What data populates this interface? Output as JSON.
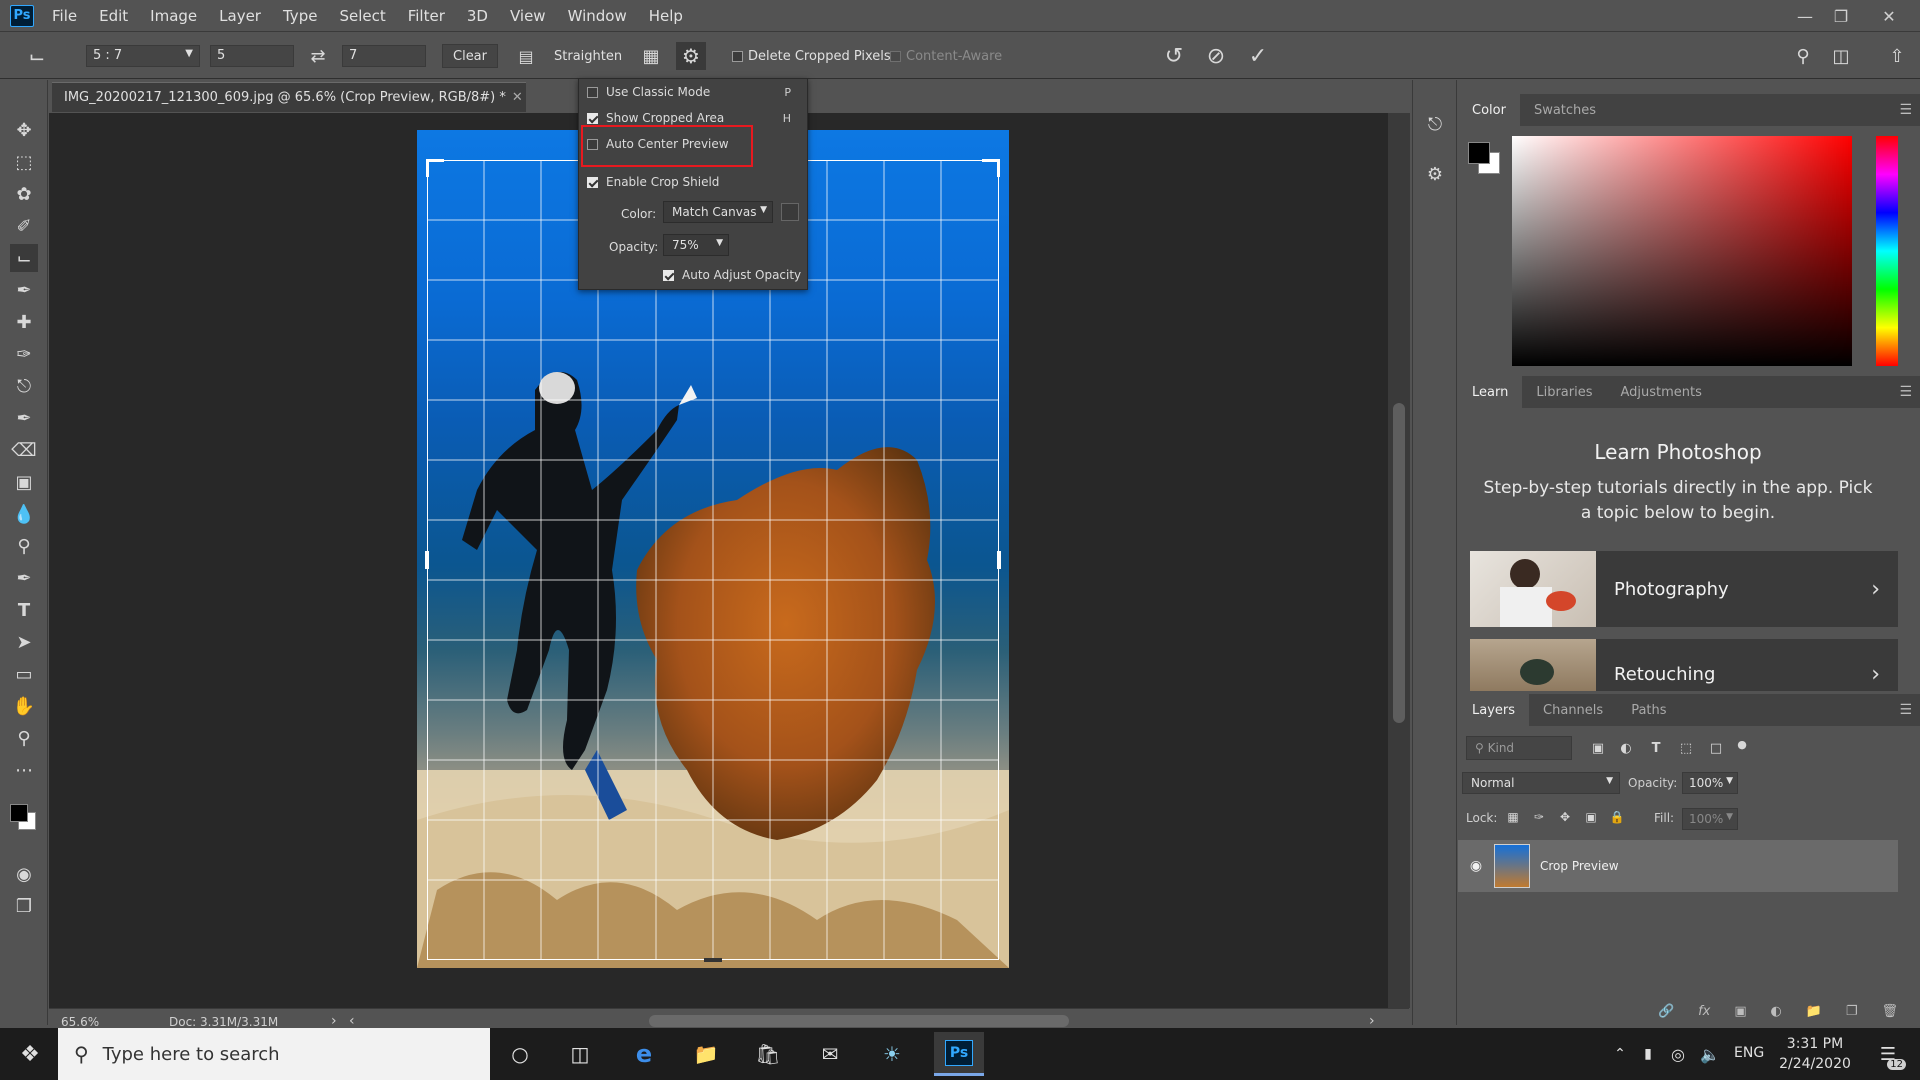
{
  "app": {
    "logo": "Ps"
  },
  "menu": [
    "File",
    "Edit",
    "Image",
    "Layer",
    "Type",
    "Select",
    "Filter",
    "3D",
    "View",
    "Window",
    "Help"
  ],
  "options_bar": {
    "ratio": "5 : 7",
    "width": "5",
    "height": "7",
    "clear_label": "Clear",
    "straighten_label": "Straighten",
    "delete_cropped_label": "Delete Cropped Pixels",
    "content_aware_label": "Content-Aware"
  },
  "document": {
    "tab_title": "IMG_20200217_121300_609.jpg @ 65.6% (Crop Preview, RGB/8#) *",
    "zoom": "65.6%",
    "doc_info": "Doc: 3.31M/3.31M"
  },
  "gear_menu": {
    "items": [
      {
        "label": "Use Classic Mode",
        "key": "P",
        "checked": false
      },
      {
        "label": "Show Cropped Area",
        "key": "H",
        "checked": true
      },
      {
        "label": "Auto Center Preview",
        "key": "",
        "checked": false
      },
      {
        "label": "Enable Crop Shield",
        "key": "",
        "checked": true
      }
    ],
    "color_label": "Color:",
    "color_value": "Match Canvas",
    "opacity_label": "Opacity:",
    "opacity_value": "75%",
    "auto_adjust_label": "Auto Adjust Opacity"
  },
  "color_panel": {
    "tabs": [
      "Color",
      "Swatches"
    ]
  },
  "learn_panel": {
    "tabs": [
      "Learn",
      "Libraries",
      "Adjustments"
    ],
    "title": "Learn Photoshop",
    "description": "Step-by-step tutorials directly in the app. Pick a topic below to begin.",
    "cards": [
      "Photography",
      "Retouching"
    ]
  },
  "layers_panel": {
    "tabs": [
      "Layers",
      "Channels",
      "Paths"
    ],
    "kind_placeholder": "Kind",
    "blend_mode": "Normal",
    "opacity_label": "Opacity:",
    "opacity_value": "100%",
    "lock_label": "Lock:",
    "fill_label": "Fill:",
    "fill_value": "100%",
    "layer_name": "Crop Preview"
  },
  "taskbar": {
    "search_placeholder": "Type here to search",
    "language": "ENG",
    "time": "3:31 PM",
    "date": "2/24/2020",
    "notification_count": "12"
  },
  "colors": {
    "accent_red": "#e8191f",
    "panel_bg": "#535353",
    "canvas_bg": "#282828"
  }
}
